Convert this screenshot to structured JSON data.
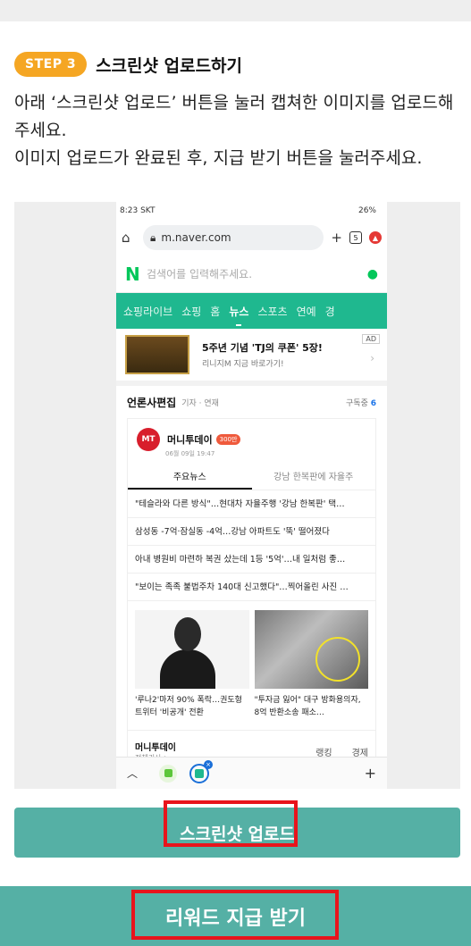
{
  "step": {
    "badge": "STEP 3",
    "title": "스크린샷 업로드하기",
    "badge_color": "#f5a623"
  },
  "instructions": [
    "아래 ‘스크린샷 업로드’ 버튼을 눌러 캡쳐한 이미지를 업로드해주세요.",
    "이미지 업로드가 완료된 후, 지급 받기 버튼을 눌러주세요."
  ],
  "screenshot": {
    "status": {
      "time": "8:23 SKT",
      "right": "26%"
    },
    "browser": {
      "url": "m.naver.com",
      "tab_count": "5"
    },
    "search": {
      "logo": "N",
      "placeholder": "검색어를 입력해주세요."
    },
    "nav": {
      "items": [
        "쇼핑라이브",
        "쇼핑",
        "홈",
        "뉴스",
        "스포츠",
        "연예",
        "경"
      ],
      "active": "뉴스"
    },
    "ad": {
      "title": "5주년 기념 'TJ의 쿠폰' 5장!",
      "subtitle": "리니지M 지금 바로가기!",
      "tag": "AD"
    },
    "press": {
      "title": "언론사편집",
      "sub": "기자 · 연재",
      "subscribe": "구독중",
      "subscribe_count": "6"
    },
    "card": {
      "logo": "MT",
      "publisher": "머니투데이",
      "badge": "300만",
      "date": "06월 09일 19:47",
      "tabs": [
        "주요뉴스",
        "강남 한복판에 자율주"
      ],
      "headlines": [
        "\"테슬라와 다른 방식\"…현대차 자율주행 '강남 한복판' 택…",
        "삼성동 -7억·잠실동 -4억…강남 아파트도 '뚝' 떨어졌다",
        "아내 병원비 마련하 복권 샀는데 1등 '5억'…내 일처럼 좋…",
        "\"보이는 족족 불법주차 140대 신고했다\"…찍어올린 사진 …"
      ],
      "photos": [
        {
          "caption": "'루나2'마저 90% 폭락…권도형 트위터 '비공개' 전환"
        },
        {
          "caption": "\"투자금 잃어\" 대구 방화용의자, 8억 반환소송 패소…"
        }
      ],
      "footer": {
        "name": "머니투데이",
        "sub": "전체기사 >",
        "tabs": [
          "랭킹",
          "경제"
        ]
      }
    }
  },
  "buttons": {
    "upload": "스크린샷 업로드",
    "reward": "리워드 지급 받기",
    "button_color": "#55b0a5",
    "highlight_color": "#e8141c"
  }
}
